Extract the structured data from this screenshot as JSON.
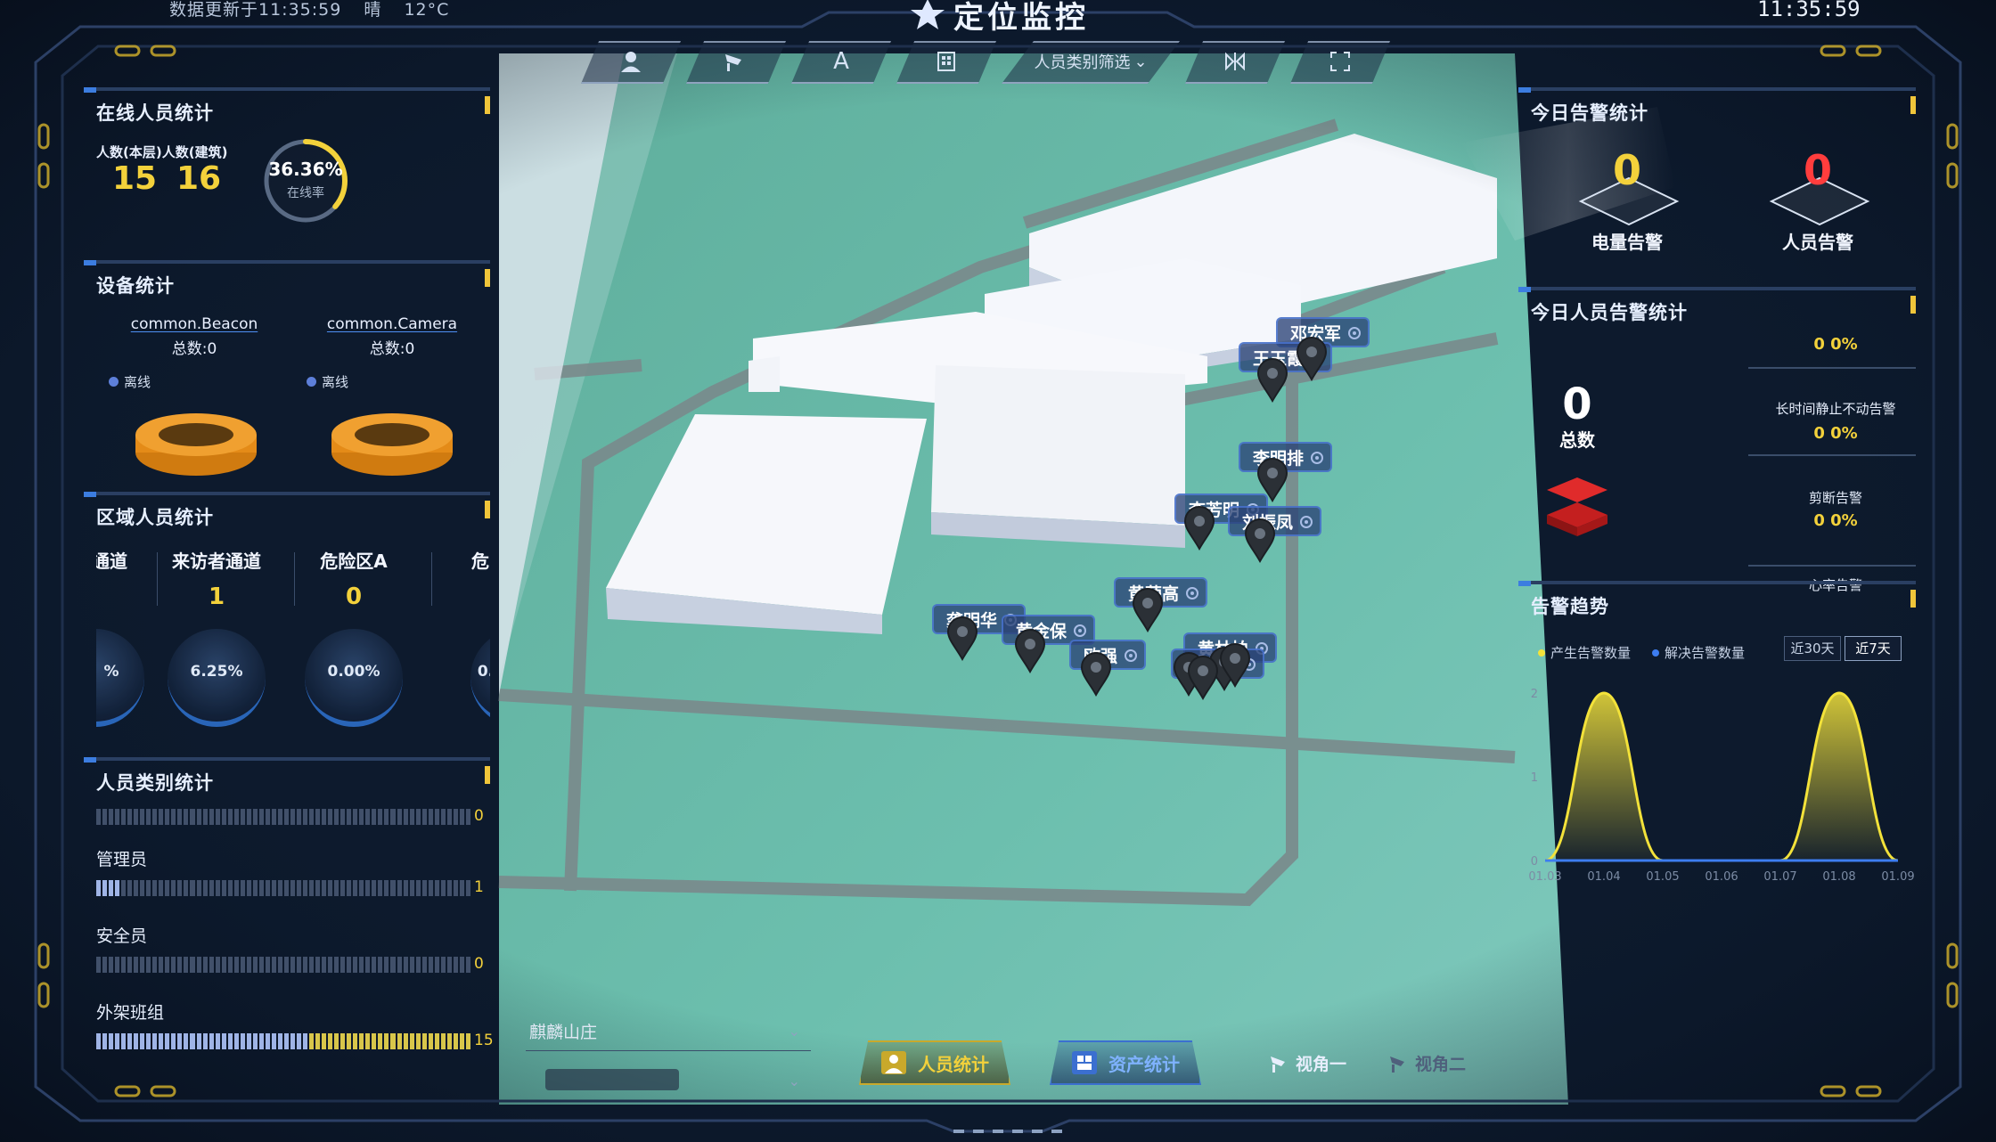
{
  "header": {
    "update_text": "数据更新于11:35:59",
    "weather": "晴",
    "temperature": "12°C",
    "title": "定位监控",
    "time": "11:35:59"
  },
  "toolbar": {
    "items": [
      {
        "icon": "person-icon"
      },
      {
        "icon": "camera-icon"
      },
      {
        "label": "A"
      },
      {
        "icon": "building-icon"
      },
      {
        "label": "人员类别筛选"
      },
      {
        "icon": "split-icon"
      },
      {
        "icon": "fullscreen-icon"
      }
    ]
  },
  "online": {
    "title": "在线人员统计",
    "label": "人数(本层)人数(建筑)",
    "floor_count": "15",
    "building_count": "16",
    "rate": "36.36%",
    "rate_label": "在线率",
    "rate_value": 0.3636
  },
  "device": {
    "title": "设备统计",
    "items": [
      {
        "name": "common.Beacon",
        "total": "总数:0",
        "legend": "离线"
      },
      {
        "name": "common.Camera",
        "total": "总数:0",
        "legend": "离线"
      }
    ]
  },
  "area": {
    "title": "区域人员统计",
    "columns": [
      {
        "name": "通道",
        "value": "",
        "pct": "%"
      },
      {
        "name": "来访者通道",
        "value": "1",
        "pct": "6.25%"
      },
      {
        "name": "危险区A",
        "value": "0",
        "pct": "0.00%"
      },
      {
        "name": "危",
        "value": "",
        "pct": "0."
      }
    ]
  },
  "category": {
    "title": "人员类别统计",
    "items": [
      {
        "name": "",
        "value": "0",
        "fill": 0
      },
      {
        "name": "管理员",
        "value": "1",
        "fill": 0.0667
      },
      {
        "name": "安全员",
        "value": "0",
        "fill": 0
      },
      {
        "name": "外架班组",
        "value": "15",
        "fill": 1.0
      }
    ]
  },
  "today_alarm": {
    "title": "今日告警统计",
    "power": {
      "value": "0",
      "label": "电量告警"
    },
    "person": {
      "value": "0",
      "label": "人员告警"
    }
  },
  "person_alarm": {
    "title": "今日人员告警统计",
    "total": "0",
    "total_label": "总数",
    "items": [
      {
        "label": "",
        "value": "0  0%"
      },
      {
        "label": "长时间静止不动告警",
        "value": "0  0%"
      },
      {
        "label": "剪断告警",
        "value": "0  0%"
      },
      {
        "label": "心率告警",
        "value": ""
      }
    ]
  },
  "trend": {
    "title": "告警趋势",
    "legend": [
      "产生告警数量",
      "解决告警数量"
    ],
    "ranges": [
      "近30天",
      "近7天"
    ],
    "active_range": "近7天",
    "colors": {
      "produced": "#f3e23a",
      "resolved": "#3d7df0"
    }
  },
  "chart_data": {
    "type": "area",
    "categories": [
      "01.03",
      "01.04",
      "01.05",
      "01.06",
      "01.07",
      "01.08",
      "01.09"
    ],
    "series": [
      {
        "name": "产生告警数量",
        "values": [
          0,
          2,
          0,
          0,
          0,
          2,
          0
        ]
      },
      {
        "name": "解决告警数量",
        "values": [
          0,
          0,
          0,
          0,
          0,
          0,
          0
        ]
      }
    ],
    "yticks": [
      "0",
      "1",
      "2"
    ],
    "ylim": [
      0,
      2
    ]
  },
  "map": {
    "people": [
      {
        "name": "邓宏军"
      },
      {
        "name": "王玉霞"
      },
      {
        "name": "李明排"
      },
      {
        "name": "李芳明"
      },
      {
        "name": "刘振凤"
      },
      {
        "name": "黄荣高"
      },
      {
        "name": "龚明华"
      },
      {
        "name": "黄金保"
      },
      {
        "name": "欧强"
      },
      {
        "name": "黄林柏"
      },
      {
        "name": "陈国创"
      }
    ]
  },
  "bottom": {
    "location": "麒麟山庄",
    "people_tab": "人员统计",
    "asset_tab": "资产统计",
    "view1": "视角一",
    "view2": "视角二"
  }
}
